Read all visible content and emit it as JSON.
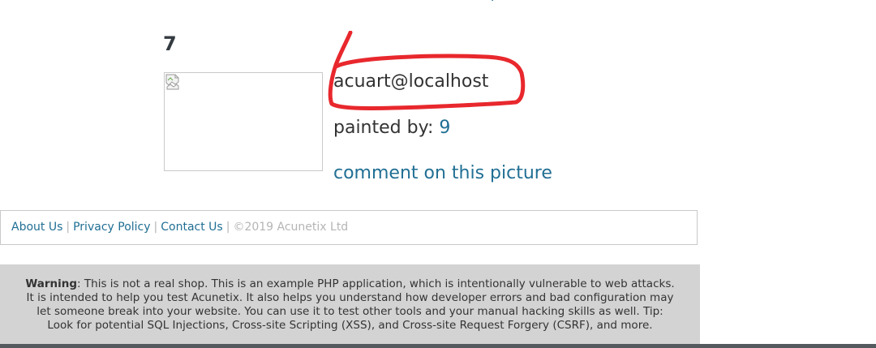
{
  "picture": {
    "title": "7",
    "image_alt": "",
    "author_email": "acuart@localhost",
    "painted_by_label": "painted by:",
    "painted_by_value": "9",
    "comment_link": "comment on this picture"
  },
  "footer": {
    "links": [
      "About Us",
      "Privacy Policy",
      "Contact Us"
    ],
    "separator": "|",
    "copyright": "©2019 Acunetix Ltd"
  },
  "warning": {
    "label": "Warning",
    "text": ": This is not a real shop. This is an example PHP application, which is intentionally vulnerable to web attacks. It is intended to help you test Acunetix. It also helps you understand how developer errors and bad configuration may let someone break into your website. You can use it to test other tools and your manual hacking skills as well. Tip: Look for potential SQL Injections, Cross-site Scripting (XSS), and Cross-site Request Forgery (CSRF), and more."
  },
  "annotation": {
    "color": "#e8282d",
    "shape": "hand-drawn-ellipse"
  },
  "colors": {
    "link": "#216f94",
    "text": "#333333",
    "warning_bg": "#d3d3d3",
    "muted": "#b5b5b5"
  }
}
